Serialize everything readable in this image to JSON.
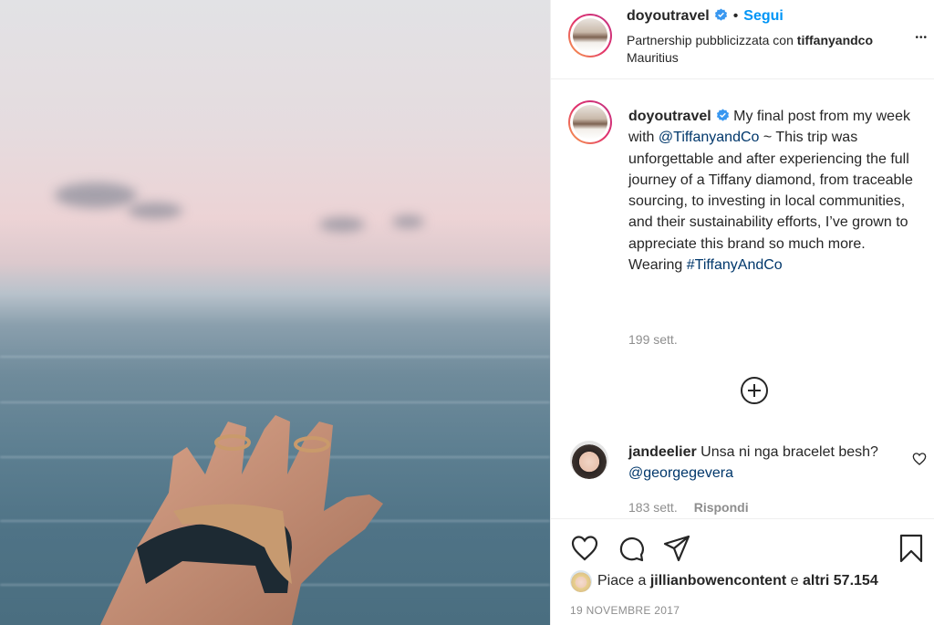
{
  "post": {
    "username": "doyoutravel",
    "follow_label": "Segui",
    "partnership_prefix": "Partnership pubblicizzata con",
    "partner": "tiffanyandco",
    "location": "Mauritius",
    "more_label": "•••"
  },
  "caption": {
    "username": "doyoutravel",
    "text_1": "My final post from my week with",
    "mention": "@TiffanyandCo",
    "text_2": "~ This trip was unforgettable and after experiencing the full journey of a Tiffany diamond, from traceable sourcing, to investing in local communities, and their sustainability efforts, I’ve grown to appreciate this brand so much more. Wearing",
    "hashtag": "#TiffanyAndCo",
    "time": "199 sett."
  },
  "comment": {
    "username": "jandeelier",
    "text": "Unsa ni nga bracelet besh?",
    "mention": "@georgegevera",
    "time": "183 sett.",
    "reply_label": "Rispondi"
  },
  "likes": {
    "prefix": "Piace a",
    "user": "jillianbowencontent",
    "middle": "e",
    "others": "altri 57.154"
  },
  "date": "19 NOVEMBRE 2017",
  "icons": {
    "verified": "verified-badge-icon",
    "plus": "plus-circle-icon",
    "heart": "heart-icon",
    "comment": "comment-icon",
    "share": "send-icon",
    "save": "bookmark-icon"
  },
  "colors": {
    "link": "#00376b",
    "follow": "#0095f6",
    "verified": "#3897f0",
    "muted": "#8e8e8e"
  }
}
